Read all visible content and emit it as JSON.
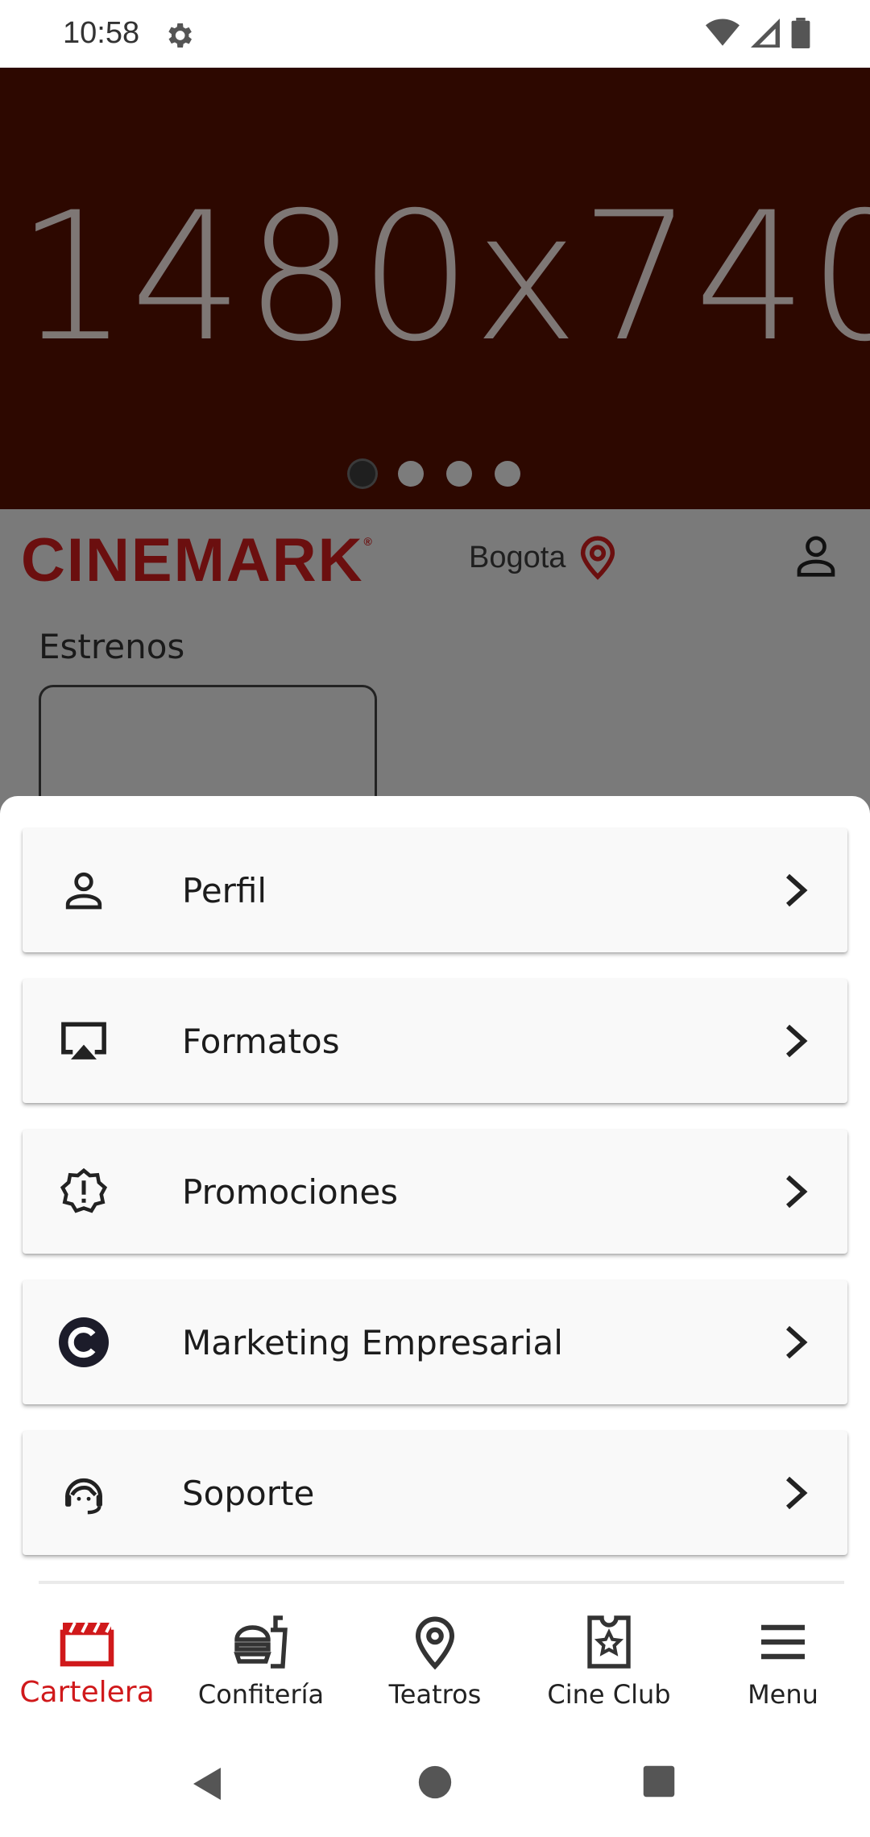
{
  "status_bar": {
    "time": "10:58",
    "icons": [
      "gear-icon",
      "wifi-icon",
      "signal-icon",
      "battery-icon"
    ]
  },
  "banner": {
    "placeholder_text": "1480x740",
    "carousel_pages": 4,
    "active_page": 1
  },
  "header": {
    "logo": "CINEMARK",
    "logo_mark": "®",
    "city": "Bogota",
    "section_title": "Estrenos"
  },
  "sheet": {
    "items": [
      {
        "label": "Perfil",
        "icon": "person-icon"
      },
      {
        "label": "Formatos",
        "icon": "airplay-icon"
      },
      {
        "label": "Promociones",
        "icon": "badge-alert-icon"
      },
      {
        "label": "Marketing Empresarial",
        "icon": "cinemark-c-icon"
      },
      {
        "label": "Soporte",
        "icon": "support-agent-icon"
      }
    ]
  },
  "bottom_nav": {
    "items": [
      {
        "label": "Cartelera",
        "icon": "clapperboard-icon",
        "active": true
      },
      {
        "label": "Confitería",
        "icon": "food-icon",
        "active": false
      },
      {
        "label": "Teatros",
        "icon": "location-pin-icon",
        "active": false
      },
      {
        "label": "Cine Club",
        "icon": "ticket-star-icon",
        "active": false
      },
      {
        "label": "Menu",
        "icon": "hamburger-icon",
        "active": false
      }
    ]
  },
  "colors": {
    "accent": "#d0191b",
    "banner_bg": "#2d0800",
    "overlay": "#7a7a7a"
  }
}
